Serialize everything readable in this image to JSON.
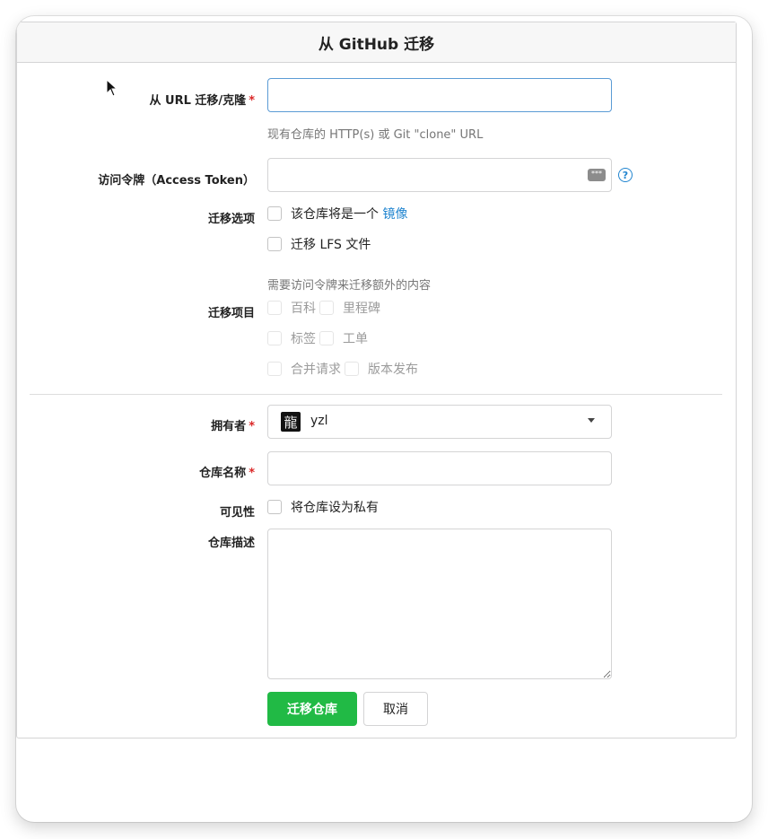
{
  "header": {
    "title": "从 GitHub 迁移"
  },
  "clone_url": {
    "label": "从 URL 迁移/克隆",
    "required": "*",
    "value": "",
    "help": "现有仓库的 HTTP(s) 或 Git \"clone\" URL"
  },
  "access_token": {
    "label": "访问令牌（Access Token）",
    "value": "",
    "key_icon_text": "***",
    "help_icon": "?"
  },
  "migrate_options": {
    "label": "迁移选项",
    "mirror_text": "该仓库将是一个",
    "mirror_link": "镜像",
    "lfs": "迁移 LFS 文件",
    "mirror_checked": false,
    "lfs_checked": false
  },
  "migrate_items": {
    "label": "迁移项目",
    "hint": "需要访问令牌来迁移额外的内容",
    "items": [
      "百科",
      "里程碑",
      "标签",
      "工单",
      "合并请求",
      "版本发布"
    ]
  },
  "owner": {
    "label": "拥有者",
    "required": "*",
    "avatar_glyph": "龍",
    "value": "yzl"
  },
  "repo_name": {
    "label": "仓库名称",
    "required": "*",
    "value": ""
  },
  "visibility": {
    "label": "可见性",
    "private_text": "将仓库设为私有",
    "checked": false
  },
  "description": {
    "label": "仓库描述",
    "value": ""
  },
  "actions": {
    "submit": "迁移仓库",
    "cancel": "取消"
  },
  "colors": {
    "primary": "#21ba45",
    "link": "#2185d0",
    "required": "#db2828"
  }
}
